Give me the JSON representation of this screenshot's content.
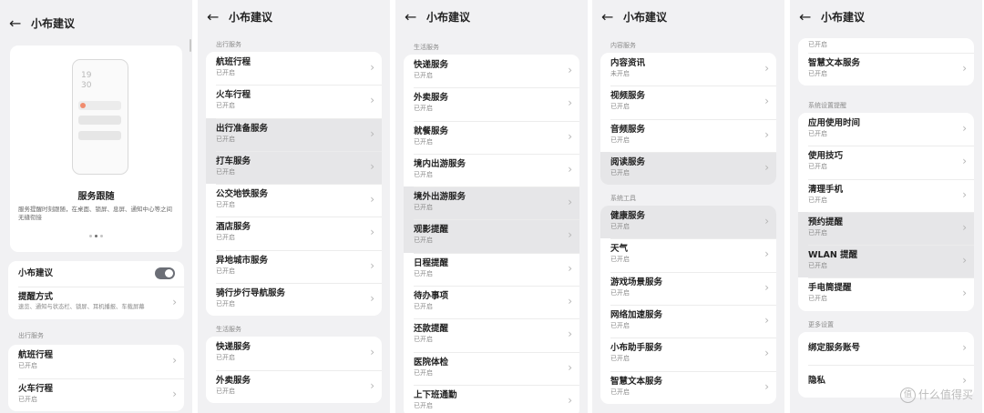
{
  "header": {
    "title": "小布建议"
  },
  "panel1": {
    "hero": {
      "clock": "19\n30",
      "title": "服务跟随",
      "desc": "服务提醒时刻跟随，在桌面、锁屏、息屏、通知中心等之间无缝衔接",
      "pages": 3,
      "active_page": 1
    },
    "toggle_row": {
      "title": "小布建议",
      "enabled": true
    },
    "reminder_row": {
      "title": "提醒方式",
      "sub": "速览、通知与状态栏、锁屏、耳机播报、车载屏幕"
    },
    "section": "出行服务",
    "items": [
      {
        "title": "航班行程",
        "sub": "已开启"
      },
      {
        "title": "火车行程",
        "sub": "已开启"
      }
    ]
  },
  "panel2": {
    "sections": [
      {
        "label": "出行服务",
        "items": [
          {
            "title": "航班行程",
            "sub": "已开启"
          },
          {
            "title": "火车行程",
            "sub": "已开启"
          },
          {
            "title": "出行准备服务",
            "sub": "已开启",
            "hl": true
          },
          {
            "title": "打车服务",
            "sub": "已开启",
            "hl": true
          },
          {
            "title": "公交地铁服务",
            "sub": "已开启"
          },
          {
            "title": "酒店服务",
            "sub": "已开启"
          },
          {
            "title": "异地城市服务",
            "sub": "已开启"
          },
          {
            "title": "骑行步行导航服务",
            "sub": "已开启"
          }
        ]
      },
      {
        "label": "生活服务",
        "items": [
          {
            "title": "快递服务",
            "sub": "已开启"
          },
          {
            "title": "外卖服务",
            "sub": "已开启"
          }
        ]
      }
    ]
  },
  "panel3": {
    "sections": [
      {
        "label": "生活服务",
        "items": [
          {
            "title": "快递服务",
            "sub": "已开启"
          },
          {
            "title": "外卖服务",
            "sub": "已开启"
          },
          {
            "title": "就餐服务",
            "sub": "已开启"
          },
          {
            "title": "境内出游服务",
            "sub": "已开启"
          },
          {
            "title": "境外出游服务",
            "sub": "已开启",
            "hl": true
          },
          {
            "title": "观影提醒",
            "sub": "已开启",
            "hl": true
          },
          {
            "title": "日程提醒",
            "sub": "已开启"
          },
          {
            "title": "待办事项",
            "sub": "已开启"
          },
          {
            "title": "还款提醒",
            "sub": "已开启"
          },
          {
            "title": "医院体检",
            "sub": "已开启"
          },
          {
            "title": "上下班通勤",
            "sub": "已开启"
          }
        ]
      }
    ]
  },
  "panel4": {
    "sections": [
      {
        "label": "内容服务",
        "items": [
          {
            "title": "内容资讯",
            "sub": "未开启"
          },
          {
            "title": "视频服务",
            "sub": "已开启"
          },
          {
            "title": "音频服务",
            "sub": "已开启"
          },
          {
            "title": "阅读服务",
            "sub": "已开启",
            "hl": true
          }
        ]
      },
      {
        "label": "系统工具",
        "items": [
          {
            "title": "健康服务",
            "sub": "已开启",
            "hl": true
          },
          {
            "title": "天气",
            "sub": "已开启"
          },
          {
            "title": "游戏场景服务",
            "sub": "已开启"
          },
          {
            "title": "网络加速服务",
            "sub": "已开启"
          },
          {
            "title": "小布助手服务",
            "sub": "已开启"
          },
          {
            "title": "智慧文本服务",
            "sub": "已开启"
          }
        ]
      }
    ]
  },
  "panel5": {
    "top_sub": "已开启",
    "top_item": {
      "title": "智慧文本服务",
      "sub": "已开启"
    },
    "sections": [
      {
        "label": "系统设置提醒",
        "items": [
          {
            "title": "应用使用时间",
            "sub": "已开启"
          },
          {
            "title": "使用技巧",
            "sub": "已开启"
          },
          {
            "title": "清理手机",
            "sub": "已开启"
          },
          {
            "title": "预约提醒",
            "sub": "已开启",
            "hl": true
          },
          {
            "title": "WLAN 提醒",
            "sub": "已开启",
            "hl": true
          },
          {
            "title": "手电筒提醒",
            "sub": "已开启"
          }
        ]
      },
      {
        "label": "更多设置",
        "items": [
          {
            "title": "绑定服务账号",
            "sub": ""
          },
          {
            "title": "隐私",
            "sub": ""
          }
        ]
      }
    ]
  },
  "watermark": {
    "icon": "值",
    "text": "什么值得买"
  }
}
